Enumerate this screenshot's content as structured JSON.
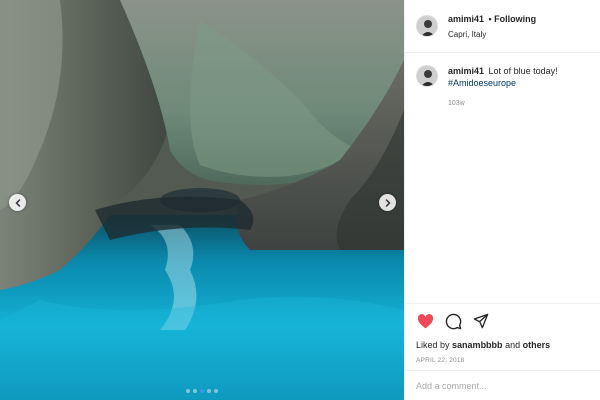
{
  "photo": {
    "prev_icon": "chevron-left-icon",
    "next_icon": "chevron-right-icon",
    "carousel_total": 5,
    "carousel_active": 3
  },
  "post": {
    "username": "amimi41",
    "follow_status": "• Following",
    "location": "Capri, Italy",
    "caption_username": "amimi41",
    "caption_text": "Lot of blue today!",
    "caption_hashtag": "#Amidoeseurope",
    "age": "103w"
  },
  "actions": {
    "like_icon": "heart-filled-icon",
    "comment_icon": "comment-bubble-icon",
    "share_icon": "share-plane-icon",
    "like_color": "#ed4956",
    "liked_by_prefix": "Liked by",
    "liked_by_user": "sanambbbb",
    "liked_by_join": "and",
    "liked_by_others": "others",
    "date": "APRIL 22, 2018"
  },
  "comment_box": {
    "placeholder": "Add a comment..."
  }
}
